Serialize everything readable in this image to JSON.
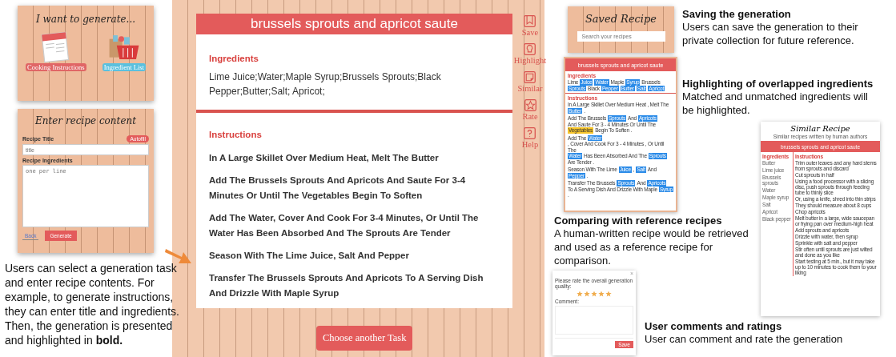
{
  "task_panel": {
    "title": "I want to generate...",
    "options": [
      {
        "label": "Cooking Instructions",
        "kind": "instructions"
      },
      {
        "label": "Ingredient List",
        "kind": "ingredients"
      }
    ]
  },
  "input_panel": {
    "title": "Enter recipe content",
    "autofill": "Autofill",
    "fields": [
      {
        "label": "Recipe Title",
        "placeholder": "title",
        "kind": "line"
      },
      {
        "label": "Recipe Ingredients",
        "placeholder": "one per line",
        "kind": "area"
      }
    ],
    "back": "Back",
    "generate": "Generate"
  },
  "caption": "Users can select a generation task and enter recipe contents. For example, to generate instructions, they can enter title and ingredients. Then, the generation is presented and highlighted in **bold.**",
  "recipe": {
    "title": "brussels sprouts and apricot saute",
    "ingredients_heading": "Ingredients",
    "ingredients": "Lime Juice;Water;Maple Syrup;Brussels Sprouts;Black Pepper;Butter;Salt; Apricot;",
    "instructions_heading": "Instructions",
    "steps": [
      "In A Large Skillet Over Medium Heat, Melt The Butter",
      "Add The Brussels Sprouts And Apricots And Saute For 3-4 Minutes Or Until The Vegetables Begin To Soften",
      "Add The Water, Cover And Cook For 3-4 Minutes, Or Until The Water Has Been Absorbed And The Sprouts Are Tender",
      "Season With The Lime Juice, Salt And Pepper",
      "Transfer The Brussels Sprouts And Apricots To A Serving Dish And Drizzle With Maple Syrup"
    ],
    "choose_button": "Choose another Task"
  },
  "sidebar": [
    {
      "label": "Save",
      "kind": "bookmark"
    },
    {
      "label": "Highlight",
      "kind": "bulb"
    },
    {
      "label": "Similar",
      "kind": "copy"
    },
    {
      "label": "Rate",
      "kind": "star"
    },
    {
      "label": "Help",
      "kind": "question"
    }
  ],
  "saved_view": {
    "title": "Saved Recipe",
    "placeholder": "Search your recipes"
  },
  "highlight_view": {
    "title": "brussels sprouts and apricot saute",
    "ingredients_heading": "Ingredients",
    "ingredients": [
      {
        "text": "Lime",
        "kind": "plain"
      },
      {
        "text": "Juice",
        "kind": "matched"
      },
      {
        "text": "Water",
        "kind": "matched"
      },
      {
        "text": "Maple",
        "kind": "plain"
      },
      {
        "text": "Syrup",
        "kind": "matched"
      },
      {
        "text": "Brussels",
        "kind": "plain"
      },
      {
        "text": "Sprouts",
        "kind": "matched"
      },
      {
        "text": "Black",
        "kind": "plain"
      },
      {
        "text": "Pepper",
        "kind": "matched"
      },
      {
        "text": "Butter",
        "kind": "matched"
      },
      {
        "text": "Salt",
        "kind": "matched"
      },
      {
        "text": "Apricot",
        "kind": "matched"
      }
    ],
    "instructions_heading": "Instructions",
    "steps": [
      [
        {
          "text": "In A Large Skillet Over Medium Heat , Melt The",
          "kind": "plain"
        },
        {
          "text": "Butter",
          "kind": "matched"
        },
        {
          "text": ".",
          "kind": "plain"
        }
      ],
      [
        {
          "text": "Add The Brussels",
          "kind": "plain"
        },
        {
          "text": "Sprouts",
          "kind": "matched"
        },
        {
          "text": "And",
          "kind": "plain"
        },
        {
          "text": "Apricots",
          "kind": "matched"
        },
        {
          "text": "And Saute For 3 - 4 Minutes Or Until The",
          "kind": "plain"
        },
        {
          "text": "Vegetables",
          "kind": "unmatched"
        },
        {
          "text": "Begin To Soften .",
          "kind": "plain"
        }
      ],
      [
        {
          "text": "Add The",
          "kind": "plain"
        },
        {
          "text": "Water",
          "kind": "matched"
        },
        {
          "text": ", Cover And Cook For 3 - 4 Minutes , Or Until The",
          "kind": "plain"
        },
        {
          "text": "Water",
          "kind": "matched"
        },
        {
          "text": "Has Been Absorbed And The",
          "kind": "plain"
        },
        {
          "text": "Sprouts",
          "kind": "matched"
        },
        {
          "text": "Are Tender .",
          "kind": "plain"
        }
      ],
      [
        {
          "text": "Season With The Lime",
          "kind": "plain"
        },
        {
          "text": "Juice",
          "kind": "matched"
        },
        {
          "text": ",",
          "kind": "plain"
        },
        {
          "text": "Salt",
          "kind": "matched"
        },
        {
          "text": "And",
          "kind": "plain"
        },
        {
          "text": "Pepper",
          "kind": "matched"
        },
        {
          "text": ".",
          "kind": "plain"
        }
      ],
      [
        {
          "text": "Transfer The Brussels",
          "kind": "plain"
        },
        {
          "text": "Sprouts",
          "kind": "matched"
        },
        {
          "text": "And",
          "kind": "plain"
        },
        {
          "text": "Apricots",
          "kind": "matched"
        },
        {
          "text": "To A Serving Dish And Drizzle With Maple",
          "kind": "plain"
        },
        {
          "text": "Syrup",
          "kind": "matched"
        },
        {
          "text": ".",
          "kind": "plain"
        }
      ]
    ]
  },
  "similar_view": {
    "title": "Similar Recipe",
    "subtitle": "Similar recipes written by human authors",
    "banner": "brussels sprouts and apricot saute",
    "ingredients_heading": "Ingredients",
    "ingredients": [
      "Butter",
      "Lime juice",
      "Brussels sprouts",
      "Water",
      "Maple syrup",
      "Salt",
      "Apricot",
      "Black pepper"
    ],
    "instructions_heading": "Instructions",
    "steps": [
      "Trim outer leaves and any hard stems from sprouts and discard",
      "Cut sprouts in half",
      "Using a food processor with a slicing disc, push sprouts through feeding tube to thinly slice",
      "Or, using a knife, shred into thin strips",
      "They should measure about 8 cups",
      "Chop apricots",
      "Melt butter in a large, wide saucepan or frying pan over medium-high heat",
      "Add sprouts and apricots",
      "Drizzle with water, then syrup",
      "Sprinkle with salt and pepper",
      "Stir often until sprouts are just wilted and done as you like",
      "Start testing at 5 min., but it may take up to 10 minutes to cook them to your liking"
    ]
  },
  "rating_view": {
    "close": "×",
    "prompt": "Please rate the overall generation quality:",
    "stars": 5,
    "comment_label": "Comment:",
    "save": "Save"
  },
  "notes": [
    {
      "heading": "Saving the generation",
      "body": "Users can save the generation to their private collection for future reference."
    },
    {
      "heading": "Highlighting of overlapped ingredients",
      "body": "Matched and unmatched ingredients will be highlighted."
    },
    {
      "heading": "Comparing with reference recipes",
      "body": "A human-written recipe would be retrieved and used as a reference recipe for comparison."
    },
    {
      "heading": "User comments and ratings",
      "body": "User can comment and rate the generation"
    }
  ]
}
